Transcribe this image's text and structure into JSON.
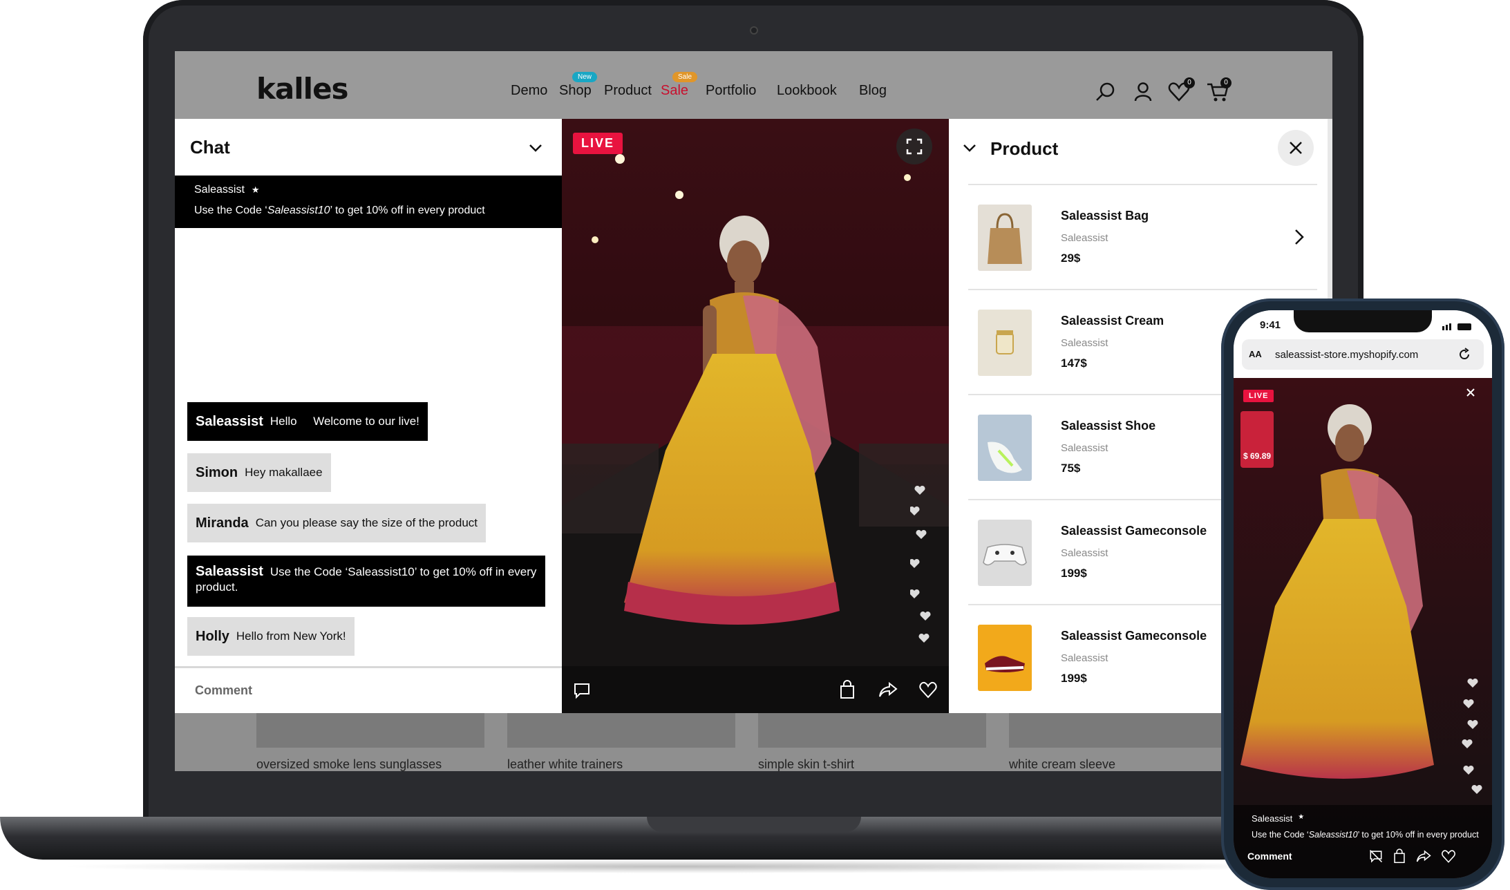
{
  "store": {
    "logo": "kalles",
    "nav": [
      {
        "label": "Demo"
      },
      {
        "label": "Shop",
        "badge": "New"
      },
      {
        "label": "Product"
      },
      {
        "label": "Sale",
        "badge": "Sale"
      },
      {
        "label": "Portfolio"
      },
      {
        "label": "Lookbook"
      },
      {
        "label": "Blog"
      }
    ],
    "wishlist_count": "0",
    "cart_count": "0",
    "grid_captions": [
      "oversized smoke lens sunglasses",
      "leather white trainers",
      "simple skin t-shirt",
      "white cream sleeve"
    ]
  },
  "chat": {
    "title": "Chat",
    "pinned": {
      "author": "Saleassist",
      "text_prefix": "Use the Code ‘",
      "code": "Saleassist10",
      "text_suffix": "’ to get 10% off in every product"
    },
    "messages": [
      {
        "author": "Saleassist",
        "text": "Hello     Welcome to our live!"
      },
      {
        "author": "Simon",
        "text": "Hey makallaee"
      },
      {
        "author": "Miranda",
        "text": "Can you please say the size of the product"
      },
      {
        "author": "Saleassist",
        "text": "Use the Code ‘Saleassist10’ to get 10% off in every product."
      },
      {
        "author": "Holly",
        "text": "Hello from New York!"
      }
    ],
    "comment_placeholder": "Comment"
  },
  "video": {
    "live_label": "LIVE"
  },
  "products": {
    "title": "Product",
    "items": [
      {
        "name": "Saleassist Bag",
        "brand": "Saleassist",
        "price": "29$"
      },
      {
        "name": "Saleassist Cream",
        "brand": "Saleassist",
        "price": "147$"
      },
      {
        "name": "Saleassist Shoe",
        "brand": "Saleassist",
        "price": "75$"
      },
      {
        "name": "Saleassist Gameconsole",
        "brand": "Saleassist",
        "price": "199$"
      },
      {
        "name": "Saleassist Gameconsole",
        "brand": "Saleassist",
        "price": "199$"
      }
    ]
  },
  "phone": {
    "time": "9:41",
    "aa_label": "AA",
    "url": "saleassist-store.myshopify.com",
    "live_label": "LIVE",
    "mini_price": "$ 69.89",
    "pinned_author": "Saleassist",
    "pinned_prefix": "Use the Code ‘",
    "pinned_code": "Saleassist10",
    "pinned_suffix": "’ to get 10% off in every product",
    "comment_placeholder": "Comment"
  },
  "colors": {
    "live_red": "#e8133f",
    "sale_red": "#c8102e",
    "new_badge": "#19a7c4",
    "sale_badge": "#e0962a"
  }
}
